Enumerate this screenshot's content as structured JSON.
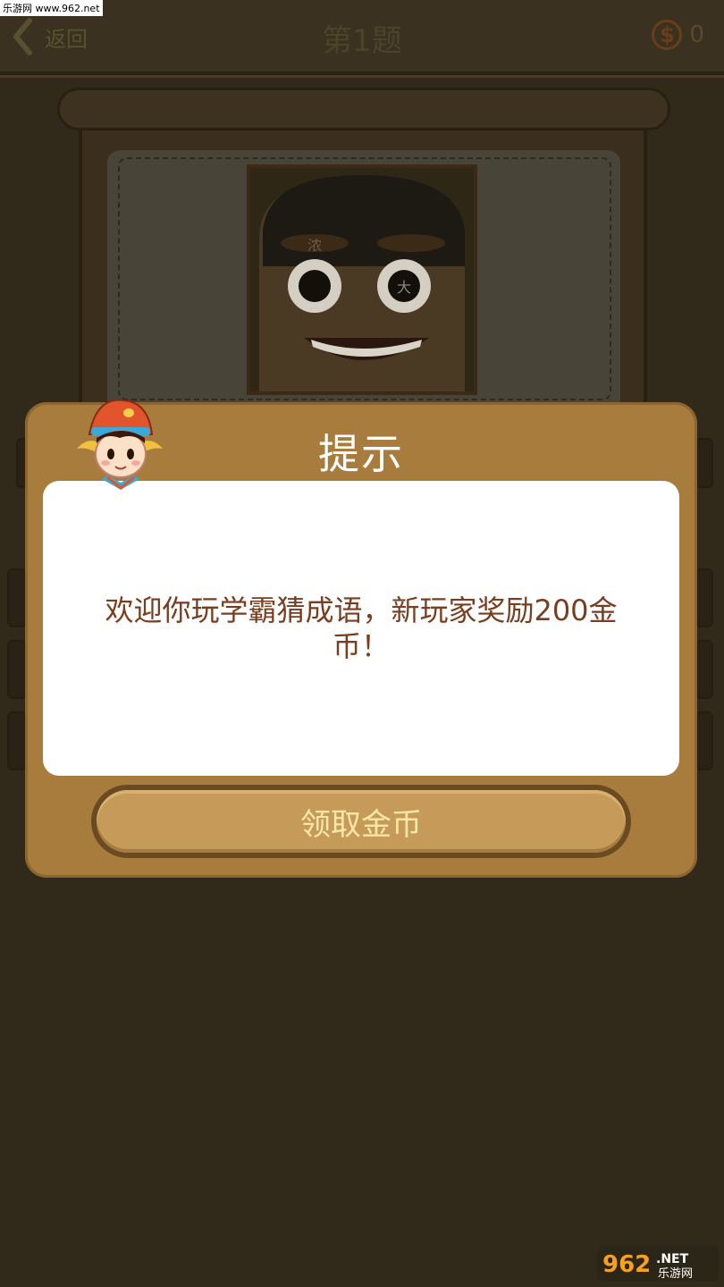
{
  "watermark_top": "乐游网 www.962.net",
  "header": {
    "back_label": "返回",
    "level_title": "第1题",
    "coin_symbol": "$",
    "coin_count": "0"
  },
  "puzzle": {
    "eyebrow_text": "浓",
    "eye_text": "大"
  },
  "dialog": {
    "title": "提示",
    "message": "欢迎你玩学霸猜成语，新玩家奖励200金币！",
    "button_label": "领取金币"
  },
  "colors": {
    "background": "#312a1a",
    "dialog": "#a77c3c",
    "message_text": "#7a3d1e",
    "button_text": "#fbe8a6"
  },
  "icons": [
    "back-chevron-icon",
    "coin-icon",
    "mascot-icon",
    "watermark-logo"
  ]
}
